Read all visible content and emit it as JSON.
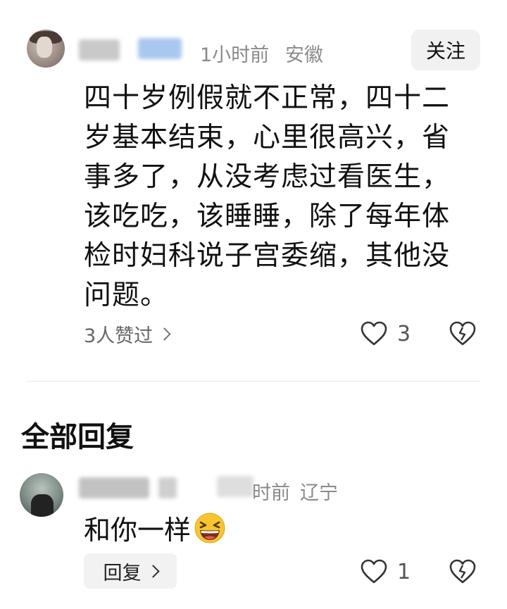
{
  "main_comment": {
    "time": "1小时前",
    "location": "安徽",
    "follow_label": "关注",
    "text_lines": [
      "四十岁例假就不正常，四十二",
      "岁基本结束，心里很高兴，省",
      "事多了，从没考虑过看医生，",
      "该吃吃，该睡睡，除了每年体",
      "检时妇科说子宫委缩，其他没",
      "问题。"
    ],
    "likers_label": "3人赞过",
    "like_count": "3"
  },
  "replies_section": {
    "title": "全部回复"
  },
  "reply": {
    "time": "时前",
    "location": "辽宁",
    "text": "和你一样",
    "emoji": "grinning-squinting-face",
    "reply_label": "回复",
    "like_count": "1"
  },
  "colors": {
    "meta_gray": "#8a8a8a",
    "button_bg": "#f1f1f1",
    "text_primary": "#111111",
    "emoji_yellow": "#f7c531"
  }
}
